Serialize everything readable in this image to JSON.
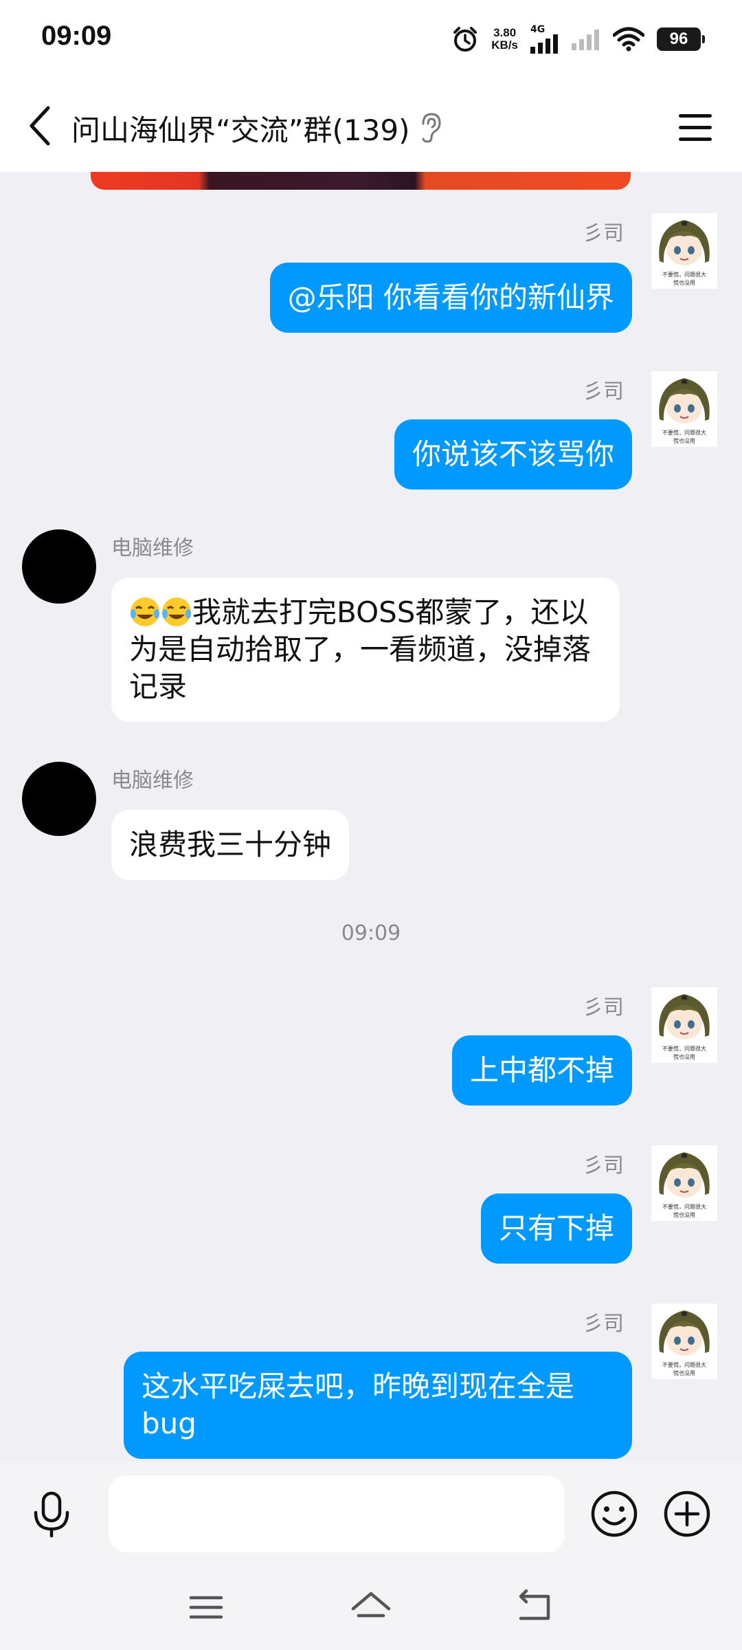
{
  "status_bar": {
    "time": "09:09",
    "net_speed_value": "3.80",
    "net_speed_unit": "KB/s",
    "network_type": "4G",
    "battery": "96"
  },
  "header": {
    "title": "问山海仙界“交流”群(139)"
  },
  "messages": [
    {
      "type": "self",
      "sender": "彡司",
      "text": "@乐阳 你看看你的新仙界"
    },
    {
      "type": "self",
      "sender": "彡司",
      "text": "你说该不该骂你"
    },
    {
      "type": "other",
      "sender": "电脑维修",
      "text": "我就去打完BOSS都蒙了，还以为是自动拾取了，一看频道，没掉落记录"
    },
    {
      "type": "other",
      "sender": "电脑维修",
      "text": "浪费我三十分钟"
    },
    {
      "type": "timestamp",
      "text": "09:09"
    },
    {
      "type": "self",
      "sender": "彡司",
      "text": "上中都不掉"
    },
    {
      "type": "self",
      "sender": "彡司",
      "text": "只有下掉"
    },
    {
      "type": "self",
      "sender": "彡司",
      "text": "这水平吃屎去吧，昨晚到现在全是bug"
    }
  ],
  "avatar_caption": "不要慌，问题很大 慌也没用",
  "input": {
    "value": "",
    "placeholder": ""
  },
  "icons": {
    "back": "chevron-left-icon",
    "ear": "ear-icon",
    "menu": "menu-icon",
    "voice": "microphone-icon",
    "emoji": "smiley-icon",
    "plus": "plus-circle-icon",
    "nav_menu": "nav-menu-icon",
    "nav_home": "nav-home-icon",
    "nav_back": "nav-back-icon"
  },
  "colors": {
    "self_bubble": "#0099ff",
    "other_bubble": "#ffffff",
    "chat_background": "#efeff4"
  }
}
